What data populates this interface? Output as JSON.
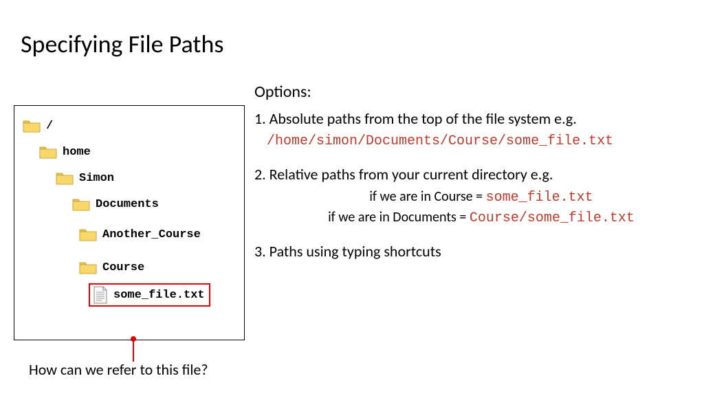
{
  "title": "Specifying File Paths",
  "tree": {
    "root": "/",
    "home": "home",
    "simon": "Simon",
    "documents": "Documents",
    "another": "Another_Course",
    "course": "Course",
    "file": "some_file.txt"
  },
  "caption": "How can we refer to this file?",
  "options": {
    "head": "Options:",
    "opt1_text": "1. Absolute paths from the top of the file system e.g.",
    "opt1_path": "/home/simon/Documents/Course/some_file.txt",
    "opt2_text": "2. Relative paths from your current directory e.g.",
    "opt2_sub1_prefix": "if we are in Course = ",
    "opt2_sub1_path": "some_file.txt",
    "opt2_sub2_prefix": "if we are in Documents = ",
    "opt2_sub2_path": "Course/some_file.txt",
    "opt3_text": "3. Paths using typing shortcuts"
  }
}
